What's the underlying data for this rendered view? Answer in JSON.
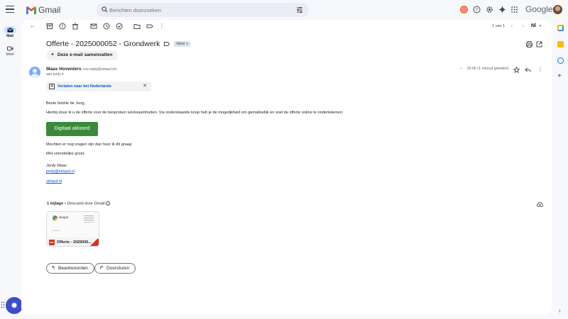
{
  "app": {
    "logo_text": "Gmail",
    "google_word": "Google"
  },
  "search": {
    "placeholder": "Berichten doorzoeken"
  },
  "rail": {
    "items": [
      {
        "label": "Mail"
      },
      {
        "label": "Meet"
      }
    ]
  },
  "toolbar": {
    "pager_text": "1 van 1",
    "language": "Nl"
  },
  "email": {
    "subject": "Offerte - 2025000052 - Grondwerk",
    "label_chip": "Inbox",
    "label_chip_close": "×",
    "summarize_label": "Deze e-mail samenvatten",
    "sender_name": "Maas Hoveniers",
    "sender_email": "<no-reply@simpul.nl>",
    "to_line": "aan jordy",
    "timestamp": "15:06 (1 minuut geleden)",
    "translate_text": "Vertalen naar het Nederlands",
    "greeting": "Beste familie de Jong,",
    "paragraph1": "Hierbij stuur ik u de offerte voor de besproken werkzaamheden. Via onderstaande knop heb je de mogelijkheid om gemakkelijk en snel de offerte online te ondertekenen:",
    "cta_label": "Digitaal akkoord",
    "paragraph2": "Mochten er nog vragen zijn dan hoor ik dit graag.",
    "closing": "Met vriendelijke groet,",
    "signature_name": "Jordy Maas",
    "signature_email": "jordy@simpul.nl",
    "signature_site": "simpul.nl"
  },
  "attachments": {
    "count_label": "1 bijlage",
    "scan_label": " • Gescand door Gmail",
    "file_name": "Offerte - 2025000...",
    "preview_brand": "simpul",
    "file_type": "PDF"
  },
  "actions": {
    "reply_label": "Beantwoorden",
    "forward_label": "Doorsturen"
  },
  "colors": {
    "accent": "#0b57d0",
    "cta_green": "#3a8a3a",
    "fab": "#3c4ec6",
    "pdf_red": "#d93025"
  }
}
